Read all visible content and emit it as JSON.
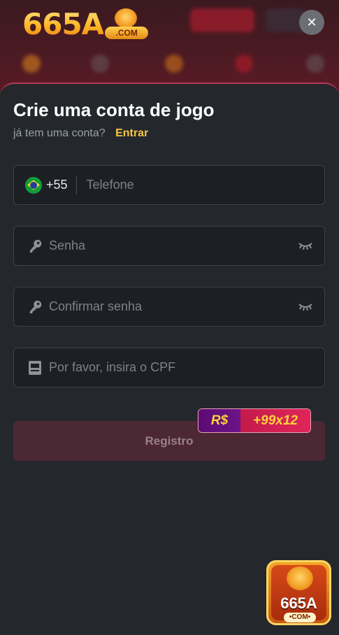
{
  "brand": {
    "logo_text": "665A",
    "logo_suffix": ".COM"
  },
  "close_label": "✕",
  "form": {
    "title": "Crie uma conta de jogo",
    "subtitle": "já tem uma conta?",
    "login_link": "Entrar",
    "country_code": "+55",
    "phone_placeholder": "Telefone",
    "password_placeholder": "Senha",
    "confirm_placeholder": "Confirmar senha",
    "cpf_placeholder": "Por favor, insira o CPF",
    "register_label": "Registro"
  },
  "promo": {
    "currency": "R$",
    "amount": "+99x12"
  },
  "app_badge": {
    "text": "665A",
    "suffix": "•COM•"
  },
  "colors": {
    "accent": "#f5c542",
    "register_bg": "#4b2833",
    "sheet_bg": "#24282d",
    "sheet_border": "#b73a52"
  }
}
